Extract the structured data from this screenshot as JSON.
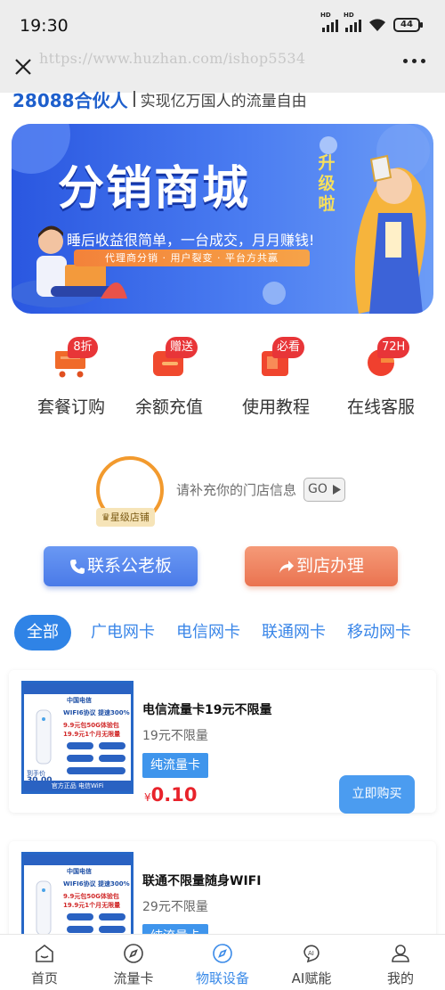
{
  "status_bar": {
    "time": "19:30",
    "battery": "44",
    "net1": "HD",
    "net2": "HD"
  },
  "nav": {
    "url": "https://www.huzhan.com/ishop5534"
  },
  "partner": {
    "title": "28088合伙人",
    "slogan": "实现亿万国人的流量自由"
  },
  "banner": {
    "title": "分销商城",
    "badge": "升级啦",
    "subtitle": "睡后收益很简单，一台成交，月月赚钱!",
    "strip": "代理商分销 · 用户裂变 · 平台方共赢"
  },
  "quick_menu": [
    {
      "label": "套餐订购",
      "badge": "8折",
      "icon": "cart-icon"
    },
    {
      "label": "余额充值",
      "badge": "赠送",
      "icon": "wallet-icon"
    },
    {
      "label": "使用教程",
      "badge": "必看",
      "icon": "book-icon"
    },
    {
      "label": "在线客服",
      "badge": "72H",
      "icon": "service-icon"
    }
  ],
  "store": {
    "tag": "星级店铺",
    "prompt": "请补充你的门店信息",
    "go": "GO"
  },
  "actions": {
    "contact": "联系公老板",
    "visit": "到店办理"
  },
  "tabs": [
    {
      "label": "全部",
      "active": true
    },
    {
      "label": "广电网卡",
      "active": false
    },
    {
      "label": "电信网卡",
      "active": false
    },
    {
      "label": "联通网卡",
      "active": false
    },
    {
      "label": "移动网卡",
      "active": false
    }
  ],
  "products": [
    {
      "title": "电信流量卡19元不限量",
      "subtitle": "19元不限量",
      "tag": "纯流量卡",
      "currency": "¥",
      "price": "0.10",
      "buy": "立即购买",
      "image": {
        "brand": "中国电信",
        "line1": "WIFI6协议 提速300%",
        "line2": "9.9元包50G体验包",
        "line3": "19.9元1个月无限量",
        "price_label": "到手价",
        "price_value": "30.00",
        "footer": "官方正品 电信WiFi"
      }
    },
    {
      "title": "联通不限量随身WIFI",
      "subtitle": "29元不限量",
      "tag": "纯流量卡",
      "currency": "¥",
      "price": "",
      "buy": "",
      "image": {
        "brand": "中国电信",
        "line1": "WIFI6协议 提速300%",
        "line2": "9.9元包50G体验包",
        "line3": "19.9元1个月无限量",
        "price_label": "",
        "price_value": "",
        "footer": ""
      }
    }
  ],
  "tabbar": [
    {
      "label": "首页",
      "icon": "home-icon",
      "active": false
    },
    {
      "label": "流量卡",
      "icon": "compass-icon",
      "active": false
    },
    {
      "label": "物联设备",
      "icon": "compass-icon",
      "active": true
    },
    {
      "label": "AI赋能",
      "icon": "ai-icon",
      "active": false
    },
    {
      "label": "我的",
      "icon": "user-icon",
      "active": false
    }
  ],
  "colors": {
    "accent": "#2f83e6",
    "price": "#e8232b",
    "badge": "#e83538",
    "store_ring": "#f29a2e"
  }
}
